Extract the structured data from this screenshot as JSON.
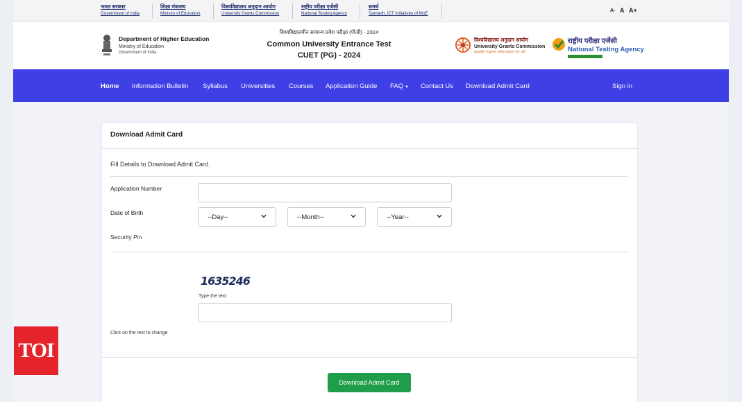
{
  "top_links": [
    {
      "hindi": "भारत सरकार",
      "english": "Government of India"
    },
    {
      "hindi": "शिक्षा मंत्रालय",
      "english": "Ministry of Education"
    },
    {
      "hindi": "विश्वविद्यालय अनुदान आयोग",
      "english": "University Grants Commission"
    },
    {
      "hindi": "राष्ट्रीय परीक्षा एजेंसी",
      "english": "National Testing Agency"
    },
    {
      "hindi": "समर्थ",
      "english": "Samarth, ICT Initiatives of MoE"
    }
  ],
  "font_controls": {
    "decrease": "A-",
    "normal": "A",
    "increase": "A+"
  },
  "dept": {
    "name": "Department of Higher Education",
    "ministry": "Ministry of Education",
    "government": "Government of India"
  },
  "title": {
    "hindi": "विश्वविद्यालयीन सामान्य प्रवेश परीक्षा (पीजी) - 2024",
    "line1": "Common University Entrance Test",
    "line2": "CUET (PG) - 2024"
  },
  "ugc": {
    "hindi": "विश्वविद्यालय अनुदान आयोग",
    "name": "University Grants Commission",
    "tagline": "quality higher education for all"
  },
  "nta": {
    "hindi": "राष्ट्रीय परीक्षा एजेंसी",
    "name": "National Testing Agency"
  },
  "nav": {
    "home": "Home",
    "info_bulletin": "Information Bulletin",
    "syllabus": "Syllabus",
    "universities": "Universities",
    "courses": "Courses",
    "app_guide": "Application Guide",
    "faq": "FAQ",
    "contact": "Contact Us",
    "download": "Download Admit Card",
    "sign_in": "Sign in"
  },
  "form": {
    "card_title": "Download Admit Card",
    "instructions": "Fill Details to Download Admit Card.",
    "app_number_label": "Application Number",
    "app_number_value": "",
    "dob_label": "Date of Birth",
    "day_placeholder": "--Day--",
    "month_placeholder": "--Month--",
    "year_placeholder": "--Year--",
    "security_pin_label": "Security Pin",
    "captcha_text": "1635246",
    "type_text_label": "Type the text",
    "captcha_input_value": "",
    "change_text_hint": "Click on the text to change",
    "submit_label": "Download Admit Card"
  },
  "watermark": "TOI",
  "colors": {
    "navbar": "#3f3fe6",
    "submit": "#1f9d4a",
    "toi": "#e5232b"
  }
}
